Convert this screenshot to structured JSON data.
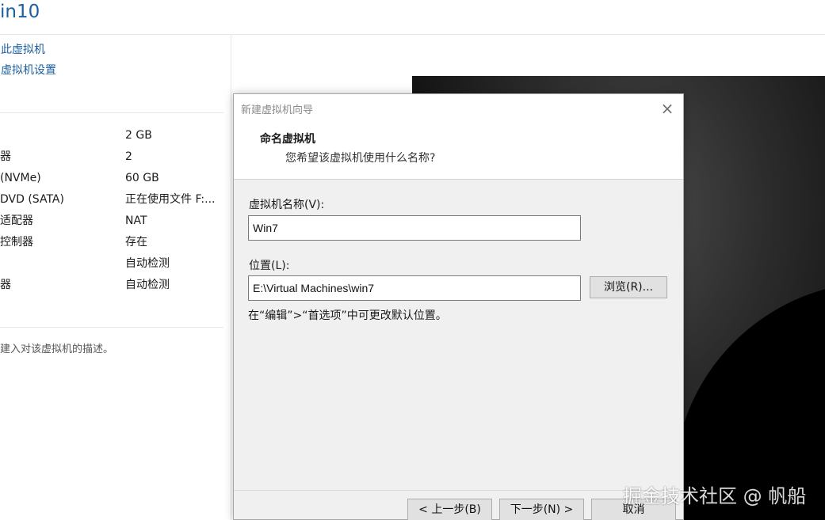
{
  "vm": {
    "tab_title": "in10",
    "commands": [
      "此虚拟机",
      "虚拟机设置"
    ],
    "devices": [
      {
        "name": "",
        "value": "2 GB"
      },
      {
        "name": "器",
        "value": "2"
      },
      {
        "name": "(NVMe)",
        "value": "60 GB"
      },
      {
        "name": "DVD (SATA)",
        "value": "正在使用文件 F:..."
      },
      {
        "name": "适配器",
        "value": "NAT"
      },
      {
        "name": " 控制器",
        "value": "存在"
      },
      {
        "name": "",
        "value": "自动检测"
      },
      {
        "name": "器",
        "value": "自动检测"
      }
    ],
    "description_placeholder": "建入对该虚拟机的描述。"
  },
  "dialog": {
    "window_title": "新建虚拟机向导",
    "close_glyph": "×",
    "heading": "命名虚拟机",
    "subheading": "您希望该虚拟机使用什么名称?",
    "name_label": "虚拟机名称(V):",
    "name_value": "Win7",
    "location_label": "位置(L):",
    "location_value": "E:\\Virtual Machines\\win7",
    "browse_label": "浏览(R)...",
    "hint": "在“编辑”>“首选项”中可更改默认位置。",
    "back_label": "< 上一步(B)",
    "next_label": "下一步(N) >",
    "cancel_label": "取消"
  },
  "watermark": "掘金技术社区 @ 帆船",
  "colors": {
    "link": "#1b5f9e",
    "dialog_bg": "#f0f0f0",
    "button_bg": "#e1e1e1"
  }
}
